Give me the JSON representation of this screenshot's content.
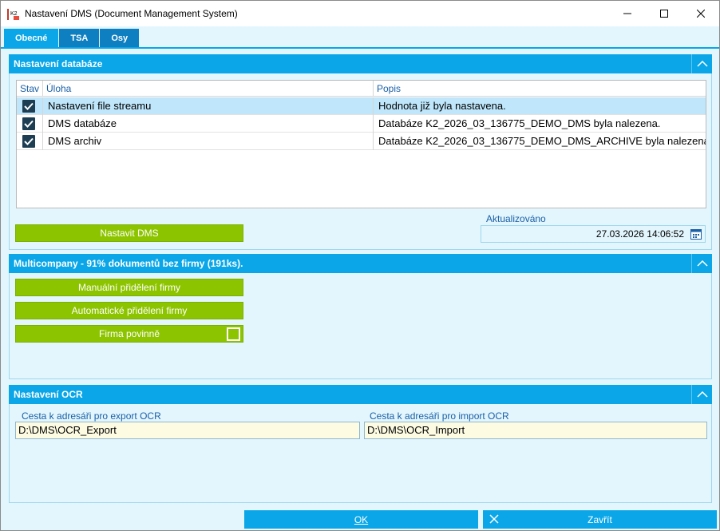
{
  "window": {
    "title": "Nastavení DMS (Document Management System)",
    "icon_label": "K2"
  },
  "tabs": [
    {
      "label": "Obecné",
      "active": true
    },
    {
      "label": "TSA",
      "active": false
    },
    {
      "label": "Osy",
      "active": false
    }
  ],
  "database_section": {
    "title": "Nastavení databáze",
    "columns": [
      "Stav",
      "Úloha",
      "Popis"
    ],
    "rows": [
      {
        "checked": true,
        "task": "Nastavení file streamu",
        "description": "Hodnota již byla nastavena.",
        "selected": true
      },
      {
        "checked": true,
        "task": "DMS databáze",
        "description": "Databáze K2_2026_03_136775_DEMO_DMS byla nalezena.",
        "selected": false
      },
      {
        "checked": true,
        "task": "DMS archiv",
        "description": "Databáze K2_2026_03_136775_DEMO_DMS_ARCHIVE byla nalezena.",
        "selected": false
      }
    ],
    "set_button": "Nastavit DMS",
    "updated_label": "Aktualizováno",
    "updated_value": "27.03.2026 14:06:52"
  },
  "multicompany_section": {
    "title": "Multicompany - 91% dokumentů bez firmy (191ks).",
    "manual_button": "Manuální přidělení firmy",
    "auto_button": "Automatické přidělení firmy",
    "required_toggle": "Firma povinně"
  },
  "ocr_section": {
    "title": "Nastavení OCR",
    "export_label": "Cesta k adresáři pro export OCR",
    "export_value": "D:\\DMS\\OCR_Export",
    "import_label": "Cesta k adresáři pro import OCR",
    "import_value": "D:\\DMS\\OCR_Import"
  },
  "footer": {
    "ok": "OK",
    "close": "Zavřít"
  },
  "colors": {
    "accent_blue": "#0aa6e8",
    "green": "#8dc400",
    "background": "#e3f6fd"
  }
}
